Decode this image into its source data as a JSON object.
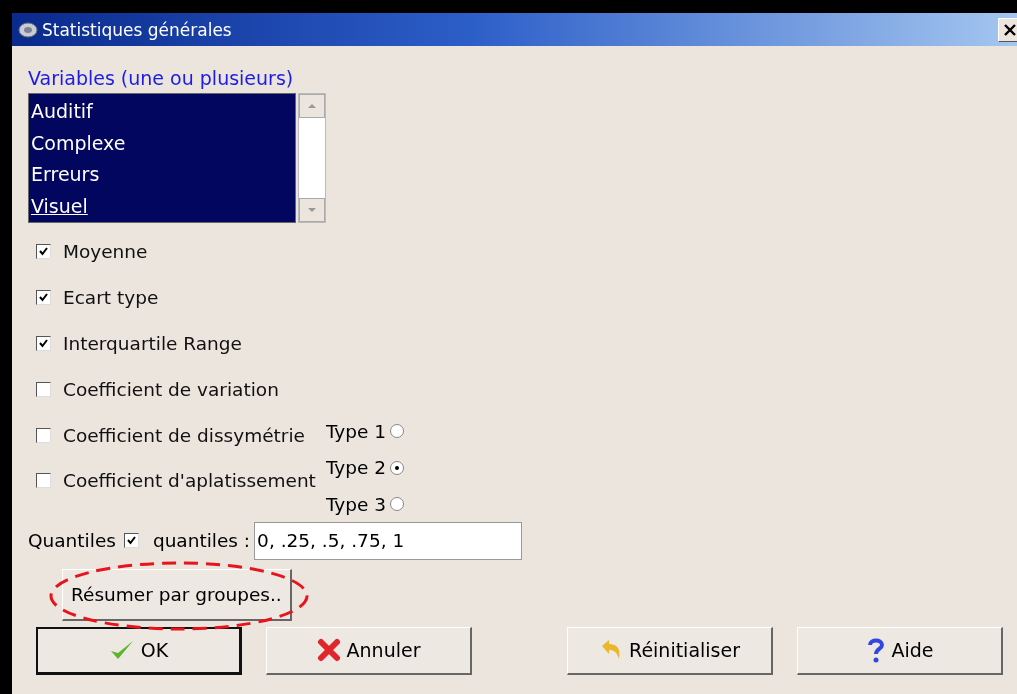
{
  "window": {
    "title": "Statistiques générales"
  },
  "variables": {
    "label": "Variables (une ou plusieurs)",
    "items": [
      {
        "label": "Auditif",
        "selected": true,
        "focused": false
      },
      {
        "label": "Complexe",
        "selected": true,
        "focused": false
      },
      {
        "label": "Erreurs",
        "selected": true,
        "focused": false
      },
      {
        "label": "Visuel",
        "selected": true,
        "focused": true
      }
    ]
  },
  "statistics": [
    {
      "label": "Moyenne",
      "checked": true
    },
    {
      "label": "Ecart type",
      "checked": true
    },
    {
      "label": "Interquartile Range",
      "checked": true
    },
    {
      "label": "Coefficient de variation",
      "checked": false
    },
    {
      "label": "Coefficient de dissymétrie",
      "checked": false
    },
    {
      "label": "Coefficient d'aplatissement",
      "checked": false
    }
  ],
  "types": [
    {
      "label": "Type 1",
      "selected": false
    },
    {
      "label": "Type 2",
      "selected": true
    },
    {
      "label": "Type 3",
      "selected": false
    }
  ],
  "quantiles": {
    "label": "Quantiles",
    "checked": true,
    "field_label": "quantiles :",
    "value": "0, .25, .5, .75, 1"
  },
  "group_button": "Résumer par groupes..",
  "buttons": [
    {
      "label": "OK",
      "kind": "ok",
      "default": true
    },
    {
      "label": "Annuler",
      "kind": "cancel",
      "default": false
    },
    {
      "label": "Réinitialiser",
      "kind": "reset",
      "default": false
    },
    {
      "label": "Aide",
      "kind": "help",
      "default": false
    }
  ]
}
